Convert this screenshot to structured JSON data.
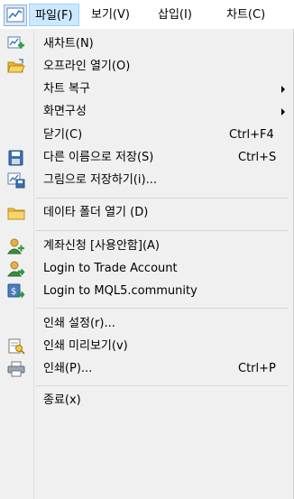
{
  "menubar": {
    "items": [
      {
        "label": "파일(F)"
      },
      {
        "label": "보기(V)"
      },
      {
        "label": "삽입(I)"
      },
      {
        "label": "차트(C)"
      }
    ]
  },
  "file_menu": {
    "items": [
      {
        "label": "새차트(N)",
        "icon": "new-chart-icon"
      },
      {
        "label": "오프라인 열기(O)",
        "icon": "open-folder-icon"
      },
      {
        "label": "차트 복구",
        "submenu": true
      },
      {
        "label": "화면구성",
        "submenu": true
      },
      {
        "label": "닫기(C)",
        "shortcut": "Ctrl+F4"
      },
      {
        "label": "다른 이름으로 저장(S)",
        "shortcut": "Ctrl+S",
        "icon": "save-icon"
      },
      {
        "label": "그림으로 저장하기(i)...",
        "icon": "save-picture-icon"
      },
      {
        "label": "데이타 폴더 열기 (D)",
        "icon": "folder-icon"
      },
      {
        "label": "계좌신청 [사용안함](A)",
        "icon": "add-account-icon"
      },
      {
        "label": "Login to Trade Account",
        "icon": "login-trade-icon"
      },
      {
        "label": "Login to MQL5.community",
        "icon": "login-mql5-icon"
      },
      {
        "label": "인쇄 설정(r)..."
      },
      {
        "label": "인쇄 미리보기(v)",
        "icon": "print-preview-icon"
      },
      {
        "label": "인쇄(P)...",
        "shortcut": "Ctrl+P",
        "icon": "printer-icon"
      },
      {
        "label": "종료(x)"
      }
    ]
  }
}
